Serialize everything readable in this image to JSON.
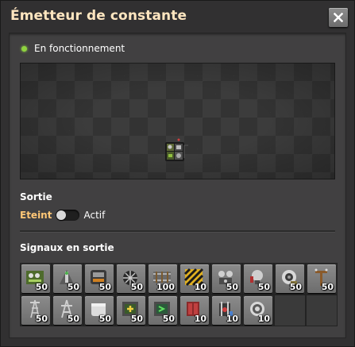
{
  "window": {
    "title": "Émetteur de constante",
    "close_icon": "close-icon"
  },
  "status": {
    "text": "En fonctionnement",
    "color": "#8fd33f"
  },
  "output": {
    "heading": "Sortie",
    "off_label": "Eteint",
    "on_label": "Actif",
    "state": "off"
  },
  "signals": {
    "heading": "Signaux en sortie",
    "slots": [
      {
        "icon": "circuit-board-icon",
        "count": "50"
      },
      {
        "icon": "rail-signal-icon",
        "count": "50"
      },
      {
        "icon": "train-stop-icon",
        "count": "50"
      },
      {
        "icon": "radar-icon",
        "count": "50"
      },
      {
        "icon": "rail-icon",
        "count": "100"
      },
      {
        "icon": "hazard-concrete-icon",
        "count": "10"
      },
      {
        "icon": "combinator-icon",
        "count": "50"
      },
      {
        "icon": "lamp-icon",
        "count": "50"
      },
      {
        "icon": "speaker-icon",
        "count": "50"
      },
      {
        "icon": "power-pole-icon",
        "count": "50"
      },
      {
        "icon": "big-pole-icon",
        "count": "50"
      },
      {
        "icon": "substation-icon",
        "count": "50"
      },
      {
        "icon": "tank-icon",
        "count": "50"
      },
      {
        "icon": "arithmetic-combinator-icon",
        "count": "50"
      },
      {
        "icon": "decider-combinator-icon",
        "count": "50"
      },
      {
        "icon": "constant-combinator-icon",
        "count": "10"
      },
      {
        "icon": "roboport-icon",
        "count": "10"
      },
      {
        "icon": "signal-speaker-icon",
        "count": "10"
      },
      {
        "icon": "",
        "count": ""
      },
      {
        "icon": "",
        "count": ""
      }
    ]
  },
  "colors": {
    "title": "#ffe6c0",
    "accent": "#ffc776",
    "panel": "#414041",
    "frame": "#313031"
  }
}
